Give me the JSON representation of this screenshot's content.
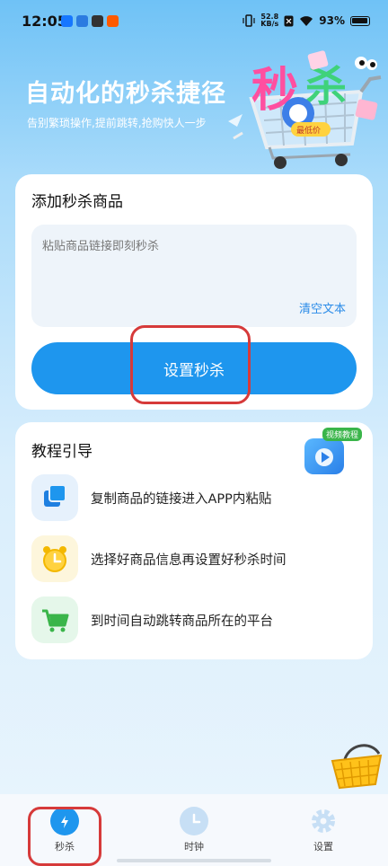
{
  "status_bar": {
    "time": "12:05",
    "net_speed_value": "52.8",
    "net_speed_unit": "KB/s",
    "battery": "93%"
  },
  "hero": {
    "title": "自动化的秒杀捷径",
    "subtitle": "告别繁琐操作,提前跳转,抢购快人一步",
    "art_text": [
      "秒",
      "杀"
    ],
    "art_tag": "最低价"
  },
  "add_card": {
    "title": "添加秒杀商品",
    "paste_placeholder": "粘贴商品链接即刻秒杀",
    "clear_label": "清空文本",
    "set_button": "设置秒杀"
  },
  "tutorial": {
    "title": "教程引导",
    "video_tag": "视频教程",
    "steps": [
      {
        "text": "复制商品的链接进入APP内粘贴",
        "icon": "copy-icon"
      },
      {
        "text": "选择好商品信息再设置好秒杀时间",
        "icon": "alarm-clock-icon"
      },
      {
        "text": "到时间自动跳转商品所在的平台",
        "icon": "shopping-cart-icon"
      }
    ]
  },
  "tabbar": {
    "tabs": [
      {
        "label": "秒杀",
        "icon": "lightning-clock-icon",
        "active": true
      },
      {
        "label": "时钟",
        "icon": "clock-icon",
        "active": false
      },
      {
        "label": "设置",
        "icon": "gear-icon",
        "active": false
      }
    ]
  },
  "colors": {
    "accent": "#1e96ee",
    "highlight": "#d63a3a",
    "background_top": "#6fc2f6"
  }
}
